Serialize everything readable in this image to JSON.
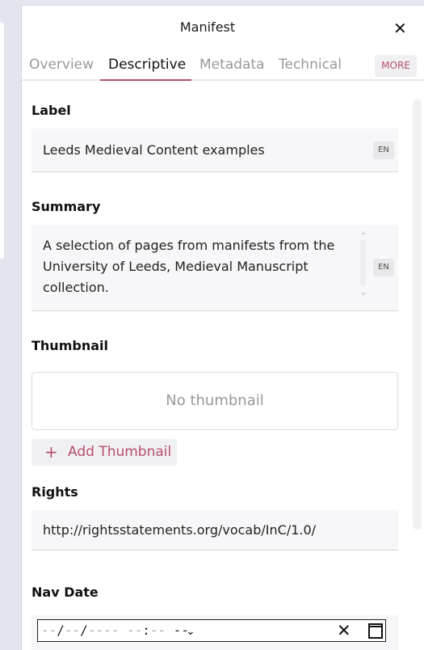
{
  "panel": {
    "title": "Manifest",
    "close_icon": "close-icon"
  },
  "tabs": {
    "items": [
      "Overview",
      "Descriptive",
      "Metadata",
      "Technical"
    ],
    "active": "Descriptive",
    "more_label": "MORE"
  },
  "fields": {
    "label": {
      "heading": "Label",
      "value": "Leeds Medieval Content examples",
      "lang": "EN"
    },
    "summary": {
      "heading": "Summary",
      "lines": [
        "A selection of pages from manifests from the",
        "University of Leeds, Medieval Manuscript",
        "collection."
      ],
      "lang": "EN"
    },
    "thumbnail": {
      "heading": "Thumbnail",
      "empty_text": "No thumbnail",
      "add_label": "Add Thumbnail",
      "add_icon": "plus-icon"
    },
    "rights": {
      "heading": "Rights",
      "value": "http://rightsstatements.org/vocab/InC/1.0/"
    },
    "nav_date": {
      "heading": "Nav Date",
      "placeholder_day": "--",
      "placeholder_month": "--",
      "placeholder_year": "----",
      "placeholder_hour": "--",
      "placeholder_minute": "--",
      "placeholder_ampm": "--",
      "clear_icon": "clear-icon",
      "calendar_icon": "calendar-icon"
    }
  },
  "colors": {
    "accent": "#b84f70",
    "field_bg": "#f7f7f9",
    "muted_text": "#999999"
  }
}
